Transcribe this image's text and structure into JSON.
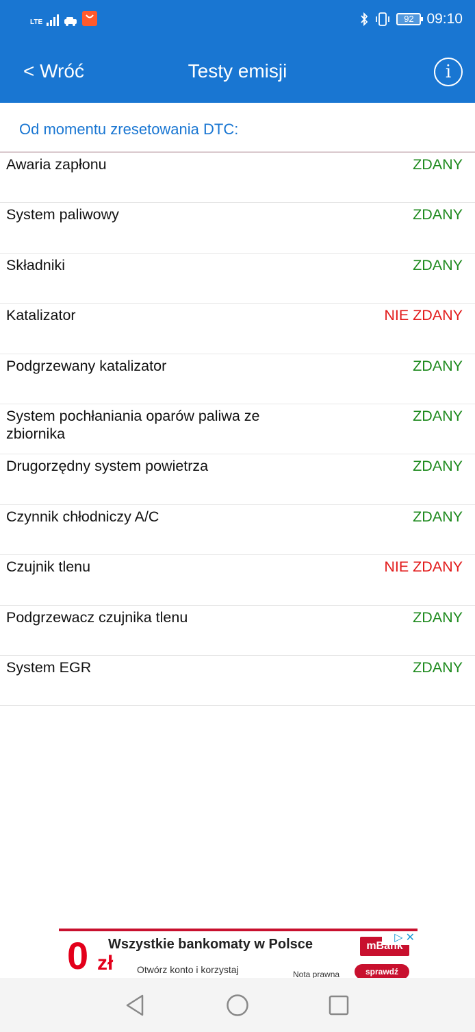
{
  "status_bar": {
    "network": "LTE",
    "battery": "92",
    "time": "09:10",
    "icons": [
      "signal-icon",
      "car-icon",
      "aliexpress-icon",
      "bluetooth-icon",
      "vibrate-icon",
      "battery-icon"
    ]
  },
  "header": {
    "back_label": "< Wróć",
    "title": "Testy emisji",
    "info_label": "i"
  },
  "section": {
    "title": "Od momentu zresetowania DTC:"
  },
  "tests": [
    {
      "name": "Awaria zapłonu",
      "result": "ZDANY",
      "passed": true
    },
    {
      "name": "System paliwowy",
      "result": "ZDANY",
      "passed": true
    },
    {
      "name": "Składniki",
      "result": "ZDANY",
      "passed": true
    },
    {
      "name": "Katalizator",
      "result": "NIE ZDANY",
      "passed": false
    },
    {
      "name": "Podgrzewany katalizator",
      "result": "ZDANY",
      "passed": true
    },
    {
      "name": "System pochłaniania oparów paliwa ze zbiornika",
      "result": "ZDANY",
      "passed": true
    },
    {
      "name": "Drugorzędny system powietrza",
      "result": "ZDANY",
      "passed": true
    },
    {
      "name": "Czynnik chłodniczy A/C",
      "result": "ZDANY",
      "passed": true
    },
    {
      "name": "Czujnik tlenu",
      "result": "NIE ZDANY",
      "passed": false
    },
    {
      "name": "Podgrzewacz czujnika tlenu",
      "result": "ZDANY",
      "passed": true
    },
    {
      "name": "System EGR",
      "result": "ZDANY",
      "passed": true
    }
  ],
  "colors": {
    "primary": "#1976d2",
    "pass": "#1e8a1e",
    "fail": "#e21b1b"
  },
  "ad": {
    "amount": "0",
    "currency": "zł",
    "headline": "Wszystkie bankomaty w Polsce",
    "subline": "Otwórz konto i korzystaj",
    "note": "Nota prawna",
    "brand": "mBank",
    "cta": "sprawdź"
  },
  "system_nav": {
    "back": "back-triangle-icon",
    "home": "home-circle-icon",
    "recents": "recents-square-icon"
  }
}
